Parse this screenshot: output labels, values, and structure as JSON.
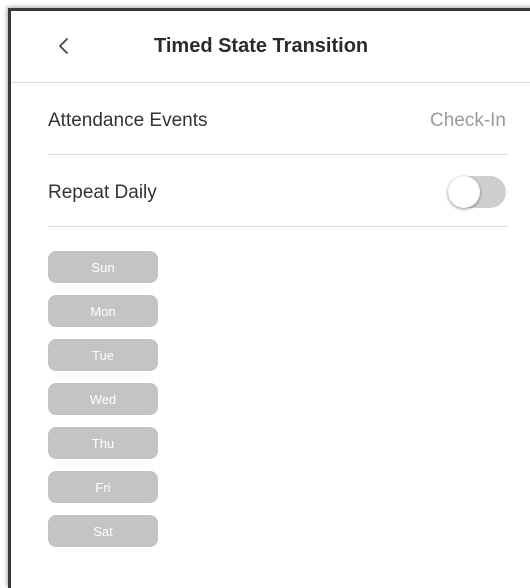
{
  "header": {
    "title": "Timed State Transition",
    "back_icon": "chevron-left-icon"
  },
  "attendance": {
    "label": "Attendance Events",
    "value": "Check-In"
  },
  "repeat": {
    "label": "Repeat Daily",
    "toggle_on": false,
    "toggle_off_color": "#cfcfcf"
  },
  "days": [
    "Sun",
    "Mon",
    "Tue",
    "Wed",
    "Thu",
    "Fri",
    "Sat"
  ],
  "colors": {
    "chip_bg": "#c4c4c4",
    "chip_text": "#ffffff",
    "value_text": "#9a9a9a"
  }
}
